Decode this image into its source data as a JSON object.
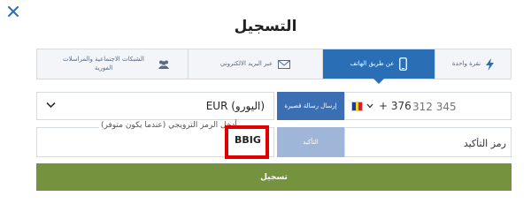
{
  "modal": {
    "title": "التسجيل"
  },
  "tabs": [
    {
      "label": "الشبكات الاجتماعية والمراسلات الفورية",
      "icon": "users-icon"
    },
    {
      "label": "عبر البريد الالكتروني",
      "icon": "envelope-icon"
    },
    {
      "label": "عن طريق الهاتف",
      "icon": "phone-icon",
      "active": true
    },
    {
      "label": "نقرة واحدة",
      "icon": "lightning-icon"
    }
  ],
  "form": {
    "currency": "EUR (اليورو)",
    "sms_button": "إرسال رسالة قصيرة",
    "phone_prefix": "+ 376",
    "phone_placeholder": "312 345",
    "promo_hint": "أدخل الرمز الترويجي (عندما يكون متوفر)",
    "promo_value": "BBIG",
    "confirm_button": "التأكيد",
    "confirm_placeholder": "رمز التأكيد",
    "register_button": "تسجيل"
  },
  "colors": {
    "accent": "#2a6fb6",
    "register": "#75923f",
    "highlight": "#e00000"
  }
}
